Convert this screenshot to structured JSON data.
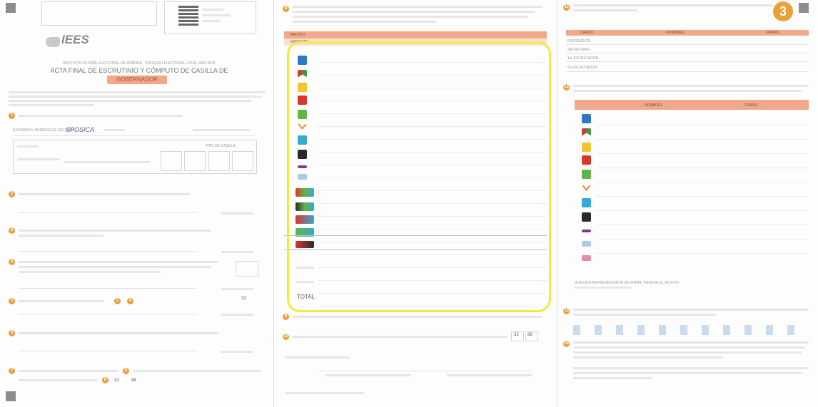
{
  "page1": {
    "logo_text": "IEES",
    "header_line": "INSTITUTO ESTATAL ELECTORAL DE SONORA · PROCESO ELECTORAL LOCAL 2020-2021",
    "title": "ACTA FINAL DE ESCRUTINIO Y CÓMPUTO DE CASILLA DE",
    "subtitle": "GOBERNADOR",
    "seccion_label": "ESCRIBA EL NÚMERO DE SECCIÓN",
    "seccion_value": "SPOSICA",
    "tipo_casilla_label": "TIPO DE CASILLA",
    "step_numbers": [
      "1",
      "2",
      "3",
      "4",
      "5",
      "6",
      "7"
    ],
    "small_box_value_a": "32",
    "small_box_value_b": "88",
    "ref_numbers": [
      "2",
      "4",
      "5",
      "6"
    ]
  },
  "page2": {
    "step_numbers": [
      "8",
      "9",
      "10"
    ],
    "col_partido": "PARTIDO",
    "col_cantidad": "CANTIDAD",
    "total_label": "TOTAL",
    "votos_label": "VOTOS",
    "party_icons": [
      "pan-logo-icon",
      "pri-logo-icon",
      "prd-logo-icon",
      "pt-logo-icon",
      "pvem-logo-icon",
      "mc-logo-icon",
      "panal-logo-icon",
      "morena-logo-icon",
      "pes-logo-icon",
      "rsp-logo-icon",
      "fxm-logo-icon",
      "coalition-logo-icon"
    ],
    "box_values": [
      "32",
      "88"
    ]
  },
  "page3": {
    "step_numbers": [
      "11",
      "12",
      "13",
      "14"
    ],
    "badge_number": "3",
    "col_cargo": "CARGO",
    "col_nombres": "NOMBRES",
    "col_firmas": "FIRMAS",
    "cargos": [
      "PRESIDENTE",
      "SECRETARIO",
      "1er ESCRUTADOR",
      "2o ESCRUTADOR"
    ],
    "col_nombre_rep": "NOMBRES",
    "col_firmas_rep": "FIRMAS",
    "note": "SI ALGÚN REPRESENTANTE NO FIRMA, INDIQUE EL MOTIVO"
  },
  "highlight_color": "#f3ea3b",
  "accent_color": "#f2a98a",
  "step_color": "#e8a13a"
}
